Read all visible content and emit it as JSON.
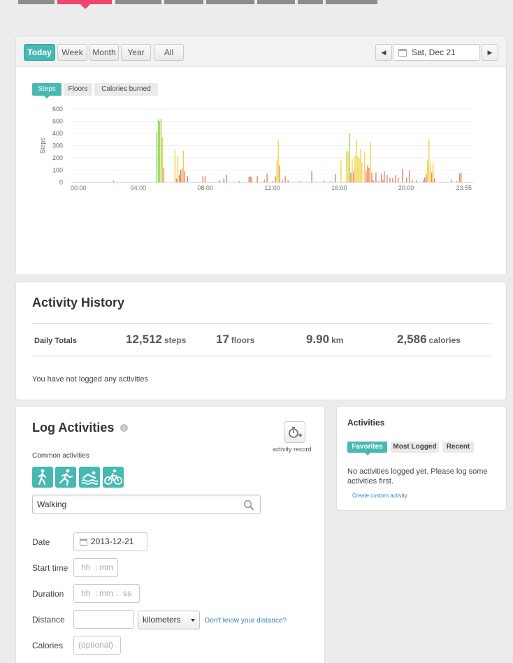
{
  "range_tabs": [
    "Today",
    "Week",
    "Month",
    "Year",
    "All"
  ],
  "active_range": "Today",
  "date_nav": {
    "label": "Sat, Dec 21",
    "prev_icon": "triangle-left-icon",
    "next_icon": "triangle-right-icon",
    "calendar_icon": "calendar-icon"
  },
  "metric_tabs": [
    "Steps",
    "Floors",
    "Calories burned"
  ],
  "active_metric": "Steps",
  "colors": {
    "accent": "#47b8b2",
    "brand_pink": "#f0466e",
    "bar_low": "#e5795c",
    "bar_mid": "#f2cf3b",
    "bar_high": "#8fd14f",
    "link": "#3a83c1"
  },
  "chart_data": {
    "type": "bar",
    "ylabel": "Steps",
    "ylim": [
      0,
      600
    ],
    "yticks": [
      "0",
      "100",
      "200",
      "300",
      "400",
      "500",
      "600"
    ],
    "xlim": [
      0,
      1440
    ],
    "xtick_labels": [
      "00:00",
      "04:00",
      "08:00",
      "12:00",
      "16:00",
      "20:00",
      "23:55"
    ],
    "xtick_minutes": [
      0,
      240,
      480,
      720,
      960,
      1200,
      1435
    ],
    "grid": true,
    "points": [
      [
        150,
        15
      ],
      [
        305,
        410
      ],
      [
        310,
        515
      ],
      [
        315,
        500
      ],
      [
        320,
        520
      ],
      [
        325,
        370
      ],
      [
        330,
        120
      ],
      [
        370,
        270
      ],
      [
        375,
        30
      ],
      [
        380,
        220
      ],
      [
        385,
        60
      ],
      [
        390,
        100
      ],
      [
        395,
        110
      ],
      [
        400,
        260
      ],
      [
        405,
        90
      ],
      [
        415,
        50
      ],
      [
        470,
        50
      ],
      [
        478,
        50
      ],
      [
        530,
        15
      ],
      [
        545,
        30
      ],
      [
        555,
        65
      ],
      [
        600,
        10
      ],
      [
        635,
        45
      ],
      [
        640,
        50
      ],
      [
        645,
        40
      ],
      [
        665,
        50
      ],
      [
        690,
        20
      ],
      [
        700,
        70
      ],
      [
        720,
        10
      ],
      [
        730,
        50
      ],
      [
        735,
        180
      ],
      [
        740,
        345
      ],
      [
        745,
        140
      ],
      [
        755,
        15
      ],
      [
        765,
        50
      ],
      [
        775,
        15
      ],
      [
        820,
        10
      ],
      [
        860,
        90
      ],
      [
        905,
        15
      ],
      [
        930,
        10
      ],
      [
        945,
        70
      ],
      [
        965,
        180
      ],
      [
        985,
        260
      ],
      [
        990,
        250
      ],
      [
        995,
        400
      ],
      [
        1000,
        80
      ],
      [
        1005,
        190
      ],
      [
        1010,
        90
      ],
      [
        1015,
        220
      ],
      [
        1020,
        350
      ],
      [
        1025,
        210
      ],
      [
        1030,
        200
      ],
      [
        1035,
        270
      ],
      [
        1040,
        160
      ],
      [
        1050,
        250
      ],
      [
        1055,
        90
      ],
      [
        1060,
        140
      ],
      [
        1065,
        120
      ],
      [
        1070,
        330
      ],
      [
        1075,
        80
      ],
      [
        1080,
        20
      ],
      [
        1090,
        80
      ],
      [
        1100,
        10
      ],
      [
        1110,
        70
      ],
      [
        1115,
        20
      ],
      [
        1120,
        90
      ],
      [
        1130,
        60
      ],
      [
        1140,
        35
      ],
      [
        1150,
        35
      ],
      [
        1160,
        60
      ],
      [
        1170,
        40
      ],
      [
        1185,
        110
      ],
      [
        1200,
        40
      ],
      [
        1210,
        100
      ],
      [
        1220,
        20
      ],
      [
        1235,
        15
      ],
      [
        1260,
        20
      ],
      [
        1265,
        40
      ],
      [
        1270,
        70
      ],
      [
        1275,
        180
      ],
      [
        1280,
        350
      ],
      [
        1285,
        150
      ],
      [
        1290,
        80
      ],
      [
        1295,
        160
      ],
      [
        1300,
        30
      ],
      [
        1360,
        20
      ],
      [
        1380,
        10
      ],
      [
        1390,
        70
      ],
      [
        1395,
        80
      ]
    ]
  },
  "history": {
    "title": "Activity History",
    "daily_label": "Daily Totals",
    "totals": [
      {
        "value": "12,512",
        "unit": "steps"
      },
      {
        "value": "17",
        "unit": "floors"
      },
      {
        "value": "9.90",
        "unit": "km"
      },
      {
        "value": "2,586",
        "unit": "calories"
      }
    ],
    "empty_message": "You have not logged any activities"
  },
  "log": {
    "title": "Log Activities",
    "info_icon": "info-icon",
    "record_icon": "stopwatch-plus-icon",
    "record_label": "activity record",
    "common_label": "Common activities",
    "common_icons": [
      "walking-icon",
      "running-icon",
      "swimming-icon",
      "cycling-icon"
    ],
    "search_value": "Walking",
    "search_icon": "search-icon",
    "date_label": "Date",
    "date_value": "2013-12-21",
    "start_label": "Start time",
    "start_hh": "hh",
    "start_mm": "mm",
    "duration_label": "Duration",
    "dur_hh": "hh",
    "dur_mm": "mm",
    "dur_ss": "ss",
    "distance_label": "Distance",
    "distance_unit": "kilometers",
    "distance_link": "Don't know your distance?",
    "calories_label": "Calories",
    "calories_placeholder": "(optional)"
  },
  "side": {
    "title": "Activities",
    "tabs": [
      "Favorites",
      "Most Logged",
      "Recent"
    ],
    "active_tab": "Favorites",
    "message": "No activities logged yet. Please log some activities first.",
    "custom_link": "Create custom activity"
  }
}
